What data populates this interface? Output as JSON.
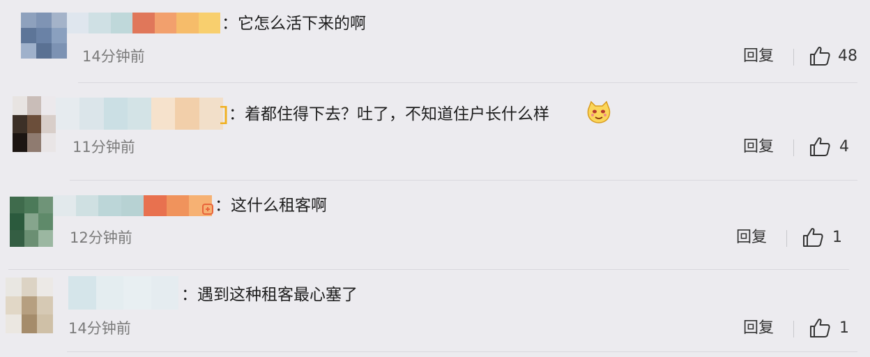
{
  "comments": [
    {
      "text": "：它怎么活下来的啊",
      "time": "14分钟前",
      "reply": "回复",
      "likes": "48"
    },
    {
      "text": "：着都住得下去？吐了，不知道住户长什么样",
      "time": "11分钟前",
      "reply": "回复",
      "likes": "4"
    },
    {
      "text": "：这什么租客啊",
      "time": "12分钟前",
      "reply": "回复",
      "likes": "1"
    },
    {
      "text": "：遇到这种租客最心塞了",
      "time": "14分钟前",
      "reply": "回复",
      "likes": "1"
    }
  ],
  "icons": {
    "like": "thumbs-up-icon",
    "emoji": "cat-face-emoji-icon",
    "badge": "member-badge-icon"
  },
  "colors": {
    "background": "#ecebef",
    "time_text": "#7a7a7a",
    "divider": "#d9d8de"
  }
}
